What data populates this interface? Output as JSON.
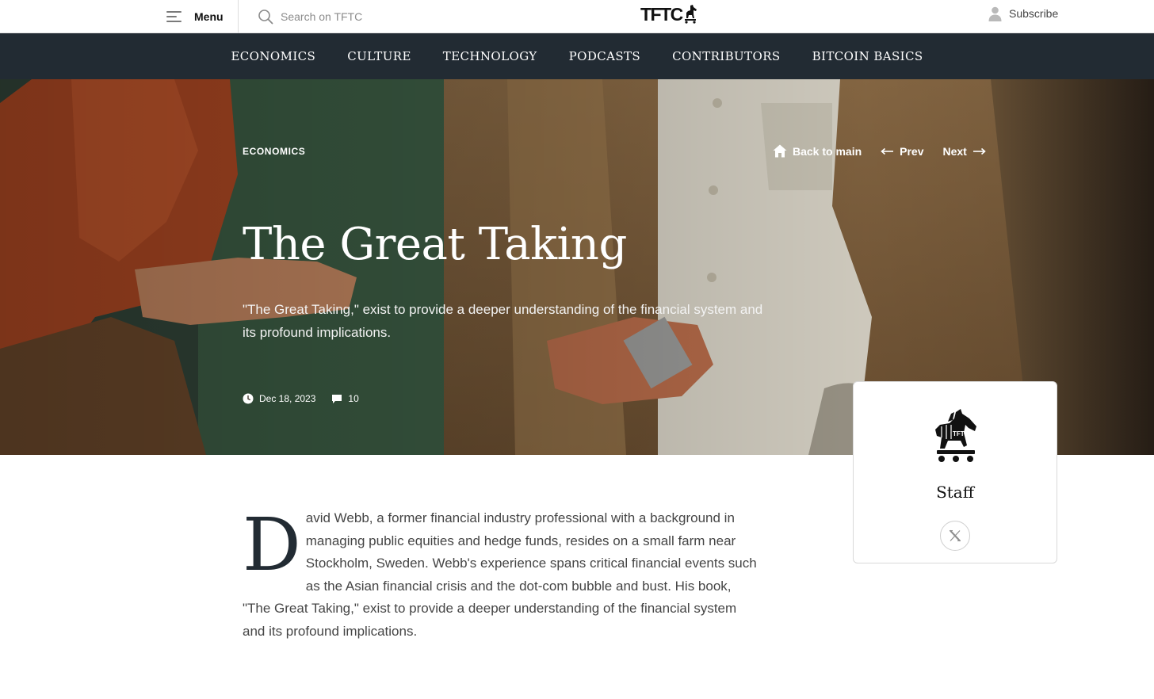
{
  "topbar": {
    "menu_label": "Menu",
    "search_placeholder": "Search on TFTC",
    "logo_text": "TFTC",
    "subscribe_label": "Subscribe"
  },
  "nav": {
    "items": [
      "ECONOMICS",
      "CULTURE",
      "TECHNOLOGY",
      "PODCASTS",
      "CONTRIBUTORS",
      "BITCOIN BASICS"
    ]
  },
  "hero": {
    "category": "ECONOMICS",
    "back_label": "Back to main",
    "prev_label": "Prev",
    "next_label": "Next",
    "title": "The Great Taking",
    "subtitle": "\"The Great Taking,\" exist to provide a deeper understanding of the financial system and its profound implications.",
    "date": "Dec 18, 2023",
    "comments": "10"
  },
  "author": {
    "name": "Staff"
  },
  "article": {
    "dropcap": "D",
    "body": "avid Webb, a former financial industry professional with a background in managing public equities and hedge funds, resides on a small farm near Stockholm, Sweden. Webb's experience spans critical financial events such as the Asian financial crisis and the dot-com bubble and bust. His book, \"The Great Taking,\" exist to provide a deeper understanding of the financial system and its profound implications."
  },
  "icons": {
    "menu": "hamburger-icon",
    "search": "search-icon",
    "user": "user-icon",
    "home": "home-icon",
    "prev": "arrow-left-icon",
    "next": "arrow-right-icon",
    "clock": "clock-icon",
    "comment": "comment-icon",
    "x": "x-twitter-icon",
    "horse": "trojan-horse-logo"
  },
  "colors": {
    "nav_bg": "#222b33",
    "dropcap": "#222b33",
    "text": "#454545"
  }
}
